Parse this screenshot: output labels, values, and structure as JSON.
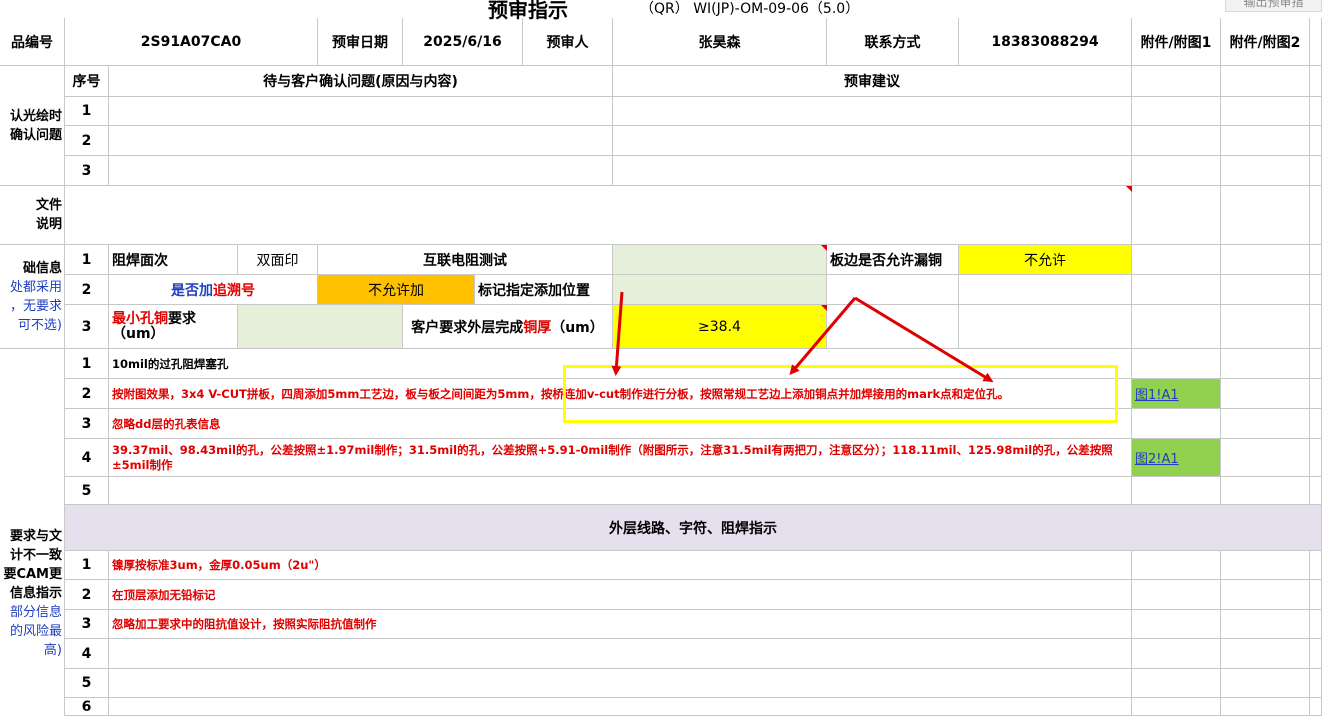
{
  "header": {
    "title": "预审指示",
    "doc_code": "（QR） WI(JP)-OM-09-06（5.0）",
    "export_button": "输出预审指"
  },
  "info": {
    "product_no_label": "品编号",
    "product_no": "2S91A07CA0",
    "date_label": "预审日期",
    "date": "2025/6/16",
    "reviewer_label": "预审人",
    "reviewer": "张昊森",
    "contact_label": "联系方式",
    "contact": "18383088294",
    "attach1_label": "附件/附图1",
    "attach2_label": "附件/附图2"
  },
  "q_header": {
    "seq": "序号",
    "question": "待与客户确认问题(原因与内容)",
    "suggestion": "预审建议"
  },
  "section1": {
    "side_line1": "认光绘时",
    "side_line2": "确认问题",
    "rows": [
      "1",
      "2",
      "3"
    ]
  },
  "section2": {
    "side_line1": "文件",
    "side_line2": "说明"
  },
  "section3": {
    "side_line1": "础信息",
    "side_line2": "处都采用",
    "side_line3": "，无要求",
    "side_line4": "可不选)",
    "rows": [
      {
        "n": "1",
        "a": "阻焊面次",
        "b": "双面印",
        "c": "互联电阻测试",
        "e": "板边是否允许漏铜",
        "f": "不允许"
      },
      {
        "n": "2",
        "a_pre": "是否加",
        "a_red": "追溯号",
        "b": "不允许加",
        "c": "标记指定添加位置"
      },
      {
        "n": "3",
        "a_red": "最小孔铜",
        "a_post": "要求",
        "a_line2": "（um）",
        "c_pre": "客户要求外层完成",
        "c_red": "铜厚",
        "c_post": "（um）",
        "d": "≥38.4"
      }
    ]
  },
  "section4": {
    "rows": [
      {
        "n": "1",
        "text": "10mil的过孔阻焊塞孔"
      },
      {
        "n": "2",
        "text": "按附图效果，3x4 V-CUT拼板，四周添加5mm工艺边，板与板之间间距为5mm，按桥连加v-cut制作进行分板，按照常规工艺边上添加铜点并加焊接用的mark点和定位孔。",
        "link": "图1!A1"
      },
      {
        "n": "3",
        "text": "忽略dd层的孔表信息"
      },
      {
        "n": "4",
        "text": "39.37mil、98.43mil的孔，公差按照±1.97mil制作；31.5mil的孔，公差按照+5.91-0mil制作（附图所示，注意31.5mil有两把刀，注意区分）；118.11mil、125.98mil的孔，公差按照±5mil制作",
        "link": "图2!A1"
      },
      {
        "n": "5",
        "text": ""
      }
    ]
  },
  "section5": {
    "header": "外层线路、字符、阻焊指示",
    "side_lines": [
      "要求与文",
      "计不一致",
      "要CAM更",
      "信息指示",
      "部分信息",
      "的风险最",
      "高)"
    ],
    "rows": [
      {
        "n": "1",
        "text": "镍厚按标准3um，金厚0.05um（2u\"）"
      },
      {
        "n": "2",
        "text": "在顶层添加无铅标记"
      },
      {
        "n": "3",
        "text": "忽略加工要求中的阻抗值设计，按照实际阻抗值制作"
      },
      {
        "n": "4",
        "text": ""
      },
      {
        "n": "5",
        "text": ""
      },
      {
        "n": "6",
        "text": ""
      }
    ]
  },
  "colors": {
    "yellow": "#ffff00",
    "orange": "#ffc000",
    "green": "#92d050",
    "light_green": "#e6efd9",
    "purple": "#e6e0ee",
    "red": "#e00000"
  }
}
